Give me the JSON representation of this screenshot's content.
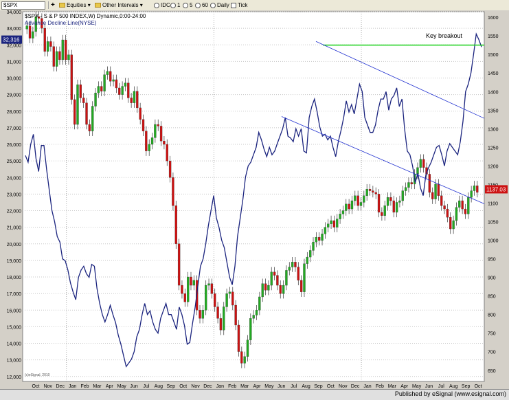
{
  "toolbar": {
    "symbol": "$SPX",
    "equities": "Equities",
    "other_intervals": "Other Intervals",
    "idc": "IDC",
    "i1": "1",
    "i5": "5",
    "i60": "60",
    "daily": "Daily",
    "tick": "Tick"
  },
  "chart_data": {
    "type": "line",
    "title": "$SPX - S & P 500 INDEX,W) Dynamic,0:00-24:00",
    "subtitle": "Advance Decline Line(NYSE)",
    "annotation": "Key breakout",
    "watermark": "(c)eSignal, 2010",
    "left_axis": {
      "min": 11700,
      "max": 34000,
      "ticks": [
        12000,
        13000,
        14000,
        15000,
        16000,
        17000,
        18000,
        19000,
        20000,
        21000,
        22000,
        23000,
        24000,
        25000,
        26000,
        27000,
        28000,
        29000,
        30000,
        31000,
        32000,
        33000,
        34000
      ]
    },
    "right_axis": {
      "min": 620,
      "max": 1615,
      "ticks": [
        650,
        700,
        750,
        800,
        850,
        900,
        950,
        1000,
        1050,
        1100,
        1150,
        1200,
        1250,
        1300,
        1350,
        1400,
        1450,
        1500,
        1550,
        1600
      ]
    },
    "last_values": {
      "left": "32,316",
      "right": "1137.03"
    },
    "x_labels": [
      "Oct",
      "Nov",
      "Dec",
      "Jan",
      "Feb",
      "Mar",
      "Apr",
      "May",
      "Jun",
      "Jul",
      "Aug",
      "Sep",
      "Oct",
      "Nov",
      "Dec",
      "Jan",
      "Feb",
      "Mar",
      "Apr",
      "May",
      "Jun",
      "Jul",
      "Aug",
      "Sep",
      "Oct",
      "Nov",
      "Dec",
      "Jan",
      "Feb",
      "Mar",
      "Apr",
      "May",
      "Jun",
      "Jul",
      "Aug",
      "Sep",
      "Oct"
    ],
    "year_labels": [
      {
        "label": "2008",
        "after": "Jan"
      },
      {
        "label": "2009",
        "after": "Jan"
      },
      {
        "label": "2010",
        "after": "Jan"
      }
    ],
    "series": [
      {
        "name": "Advance Decline Line(NYSE)",
        "color": "#1a237e",
        "axis": "right",
        "values": [
          1228,
          1210,
          1258,
          1285,
          1220,
          1185,
          1255,
          1255,
          1190,
          1135,
          1080,
          1050,
          1010,
          995,
          950,
          945,
          920,
          885,
          860,
          840,
          900,
          920,
          930,
          910,
          900,
          935,
          930,
          870,
          830,
          800,
          780,
          800,
          825,
          800,
          778,
          745,
          720,
          690,
          660,
          670,
          680,
          700,
          740,
          760,
          800,
          830,
          800,
          810,
          780,
          760,
          750,
          790,
          810,
          830,
          800,
          800,
          780,
          760,
          820,
          800,
          770,
          720,
          725,
          775,
          820,
          875,
          930,
          950,
          990,
          1040,
          1080,
          1120,
          1060,
          1035,
          1000,
          980,
          940,
          900,
          880,
          930,
          1010,
          1060,
          1110,
          1170,
          1200,
          1210,
          1230,
          1250,
          1290,
          1270,
          1245,
          1225,
          1250,
          1230,
          1240,
          1260,
          1280,
          1300,
          1330,
          1280,
          1275,
          1265,
          1300,
          1280,
          1300,
          1240,
          1235,
          1330,
          1360,
          1380,
          1345,
          1305,
          1280,
          1285,
          1270,
          1280,
          1250,
          1225,
          1265,
          1295,
          1330,
          1375,
          1345,
          1365,
          1340,
          1380,
          1420,
          1400,
          1330,
          1310,
          1290,
          1290,
          1310,
          1350,
          1380,
          1380,
          1400,
          1350,
          1380,
          1390,
          1410,
          1360,
          1380,
          1300,
          1240,
          1230,
          1200,
          1155,
          1180,
          1140,
          1120,
          1175,
          1195,
          1210,
          1230,
          1250,
          1255,
          1230,
          1200,
          1240,
          1260,
          1250,
          1240,
          1230,
          1265,
          1320,
          1400,
          1420,
          1450,
          1500,
          1555,
          1540,
          1520
        ]
      },
      {
        "name": "S & P 500 INDEX",
        "type": "candlestick",
        "axis": "left",
        "values": [
          33150,
          32400,
          32800,
          33700,
          33600,
          33000,
          31600,
          32200,
          31900,
          30700,
          31600,
          31100,
          32300,
          31100,
          31400,
          28700,
          27200,
          29600,
          28800,
          28500,
          27200,
          26800,
          28300,
          29100,
          29500,
          29200,
          30200,
          30400,
          29800,
          29900,
          29400,
          29000,
          29500,
          29700,
          28800,
          28500,
          29200,
          28200,
          27500,
          26800,
          25600,
          26000,
          26400,
          27200,
          27100,
          26200,
          26000,
          25000,
          24000,
          22300,
          20000,
          17500,
          17000,
          16500,
          18000,
          17500,
          17800,
          16000,
          15500,
          16000,
          17500,
          17600,
          17000,
          16200,
          15500,
          14800,
          16200,
          17000,
          17100,
          16300,
          15100,
          13500,
          12800,
          13200,
          14200,
          15500,
          15700,
          16000,
          16800,
          17600,
          17200,
          17500,
          18300,
          18100,
          17500,
          17000,
          17500,
          18400,
          18600,
          18900,
          18600,
          17800,
          17100,
          18800,
          19200,
          19600,
          20100,
          20400,
          20200,
          20600,
          21000,
          21200,
          21400,
          21000,
          21500,
          21800,
          22000,
          22400,
          22100,
          22600,
          22900,
          22300,
          22500,
          22900,
          23300,
          23200,
          23100,
          23000,
          21900,
          21700,
          22300,
          22800,
          22600,
          21900,
          22500,
          22600,
          23200,
          23400,
          23700,
          23600,
          24200,
          24600,
          25100,
          24600,
          24200,
          23100,
          22700,
          23600,
          22900,
          22300,
          22100,
          21600,
          20900,
          21400,
          22200,
          22600,
          22100,
          21800,
          22800,
          23200,
          23500,
          23100
        ]
      }
    ],
    "lines": [
      {
        "type": "horizontal",
        "color": "#18d018",
        "value": 1525,
        "axis": "right",
        "label": "Key breakout"
      },
      {
        "type": "channel-upper",
        "color": "#2030d0"
      },
      {
        "type": "channel-lower",
        "color": "#2030d0"
      }
    ]
  }
}
